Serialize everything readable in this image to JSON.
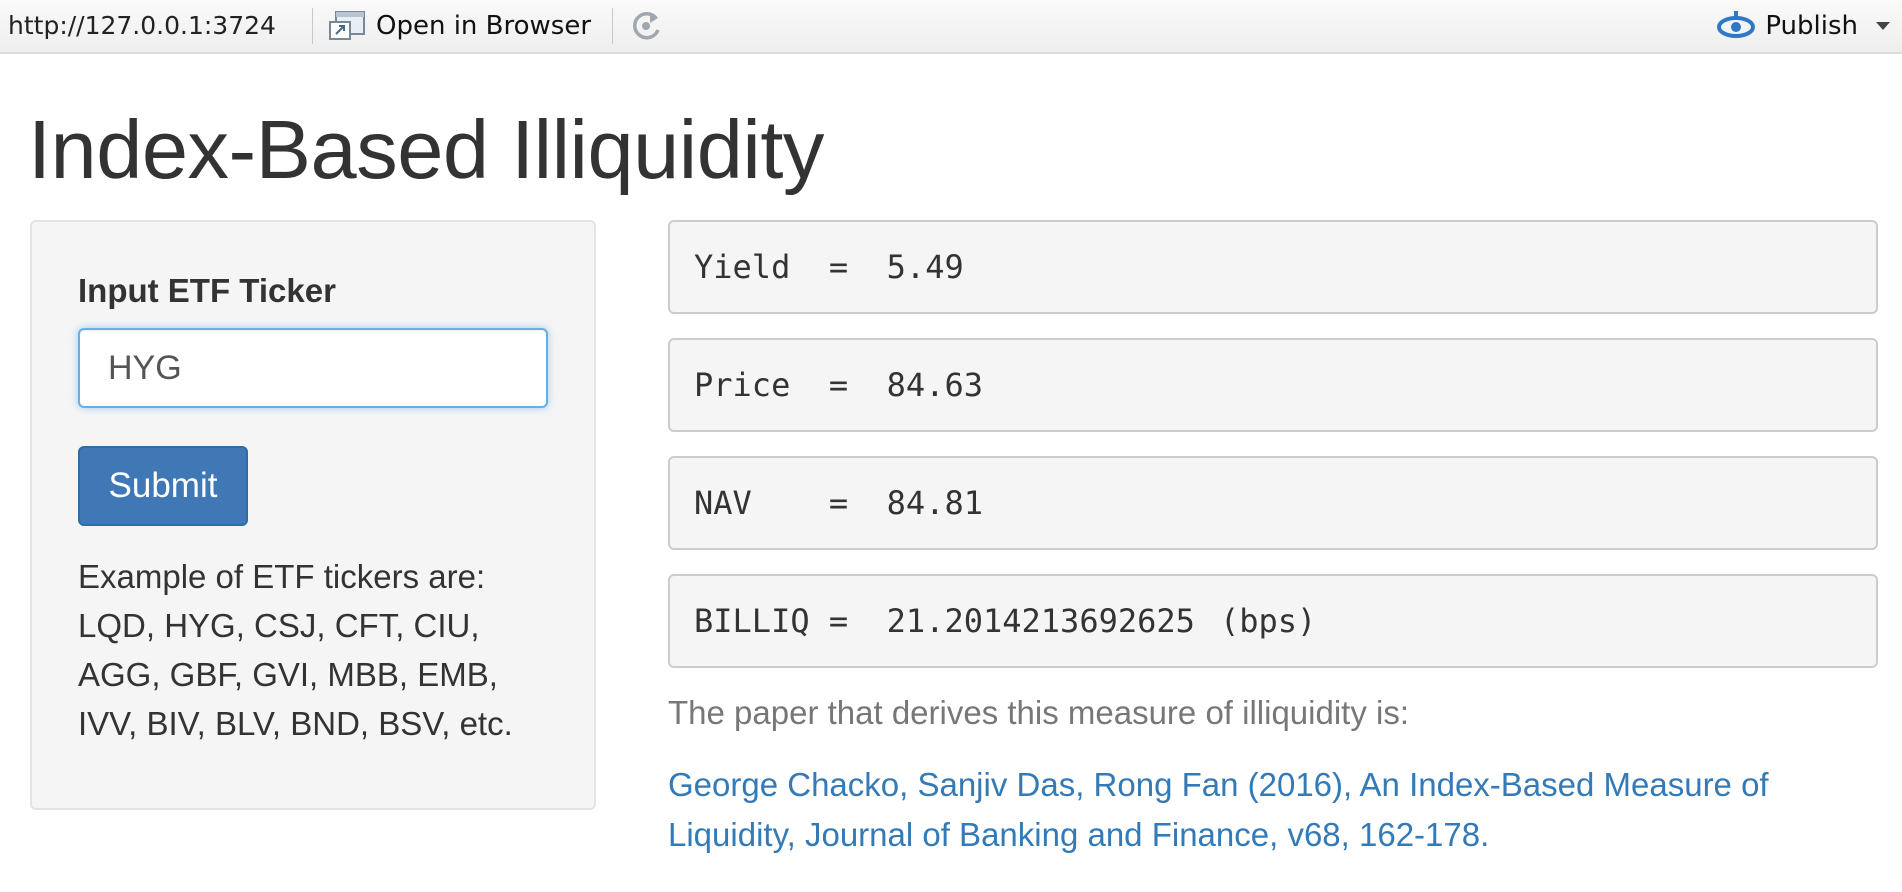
{
  "toolbar": {
    "url": "http://127.0.0.1:3724",
    "open_in_browser_label": "Open in Browser",
    "publish_label": "Publish",
    "icons": {
      "open": "open-in-browser-icon",
      "refresh": "refresh-icon",
      "publish": "publish-icon"
    }
  },
  "page": {
    "title": "Index-Based Illiquidity"
  },
  "sidebar": {
    "input_label": "Input ETF Ticker",
    "ticker_value": "HYG",
    "submit_label": "Submit",
    "examples_lines": [
      "Example of ETF tickers are:",
      "LQD, HYG, CSJ, CFT, CIU,",
      "AGG, GBF, GVI, MBB, EMB,",
      "IVV, BIV, BLV, BND, BSV, etc."
    ]
  },
  "results": {
    "yield": {
      "key": "Yield",
      "eq": "=",
      "value": "5.49"
    },
    "price": {
      "key": "Price",
      "eq": "=",
      "value": "84.63"
    },
    "nav": {
      "key": "NAV",
      "eq": "=",
      "value": "84.81"
    },
    "billiq": {
      "key": "BILLIQ",
      "eq": "=",
      "value": "21.2014213692625",
      "unit": "(bps)"
    }
  },
  "paper": {
    "intro": "The paper that derives this measure of illiquidity is:",
    "citation_line1": "George Chacko, Sanjiv Das, Rong Fan (2016), An Index-Based Measure of",
    "citation_line2": "Liquidity, Journal of Banking and Finance, v68, 162-178."
  },
  "colors": {
    "accent": "#337ab7",
    "button": "#3f78b4",
    "panel_bg": "#f5f5f5",
    "publish_icon": "#2f78c4"
  }
}
